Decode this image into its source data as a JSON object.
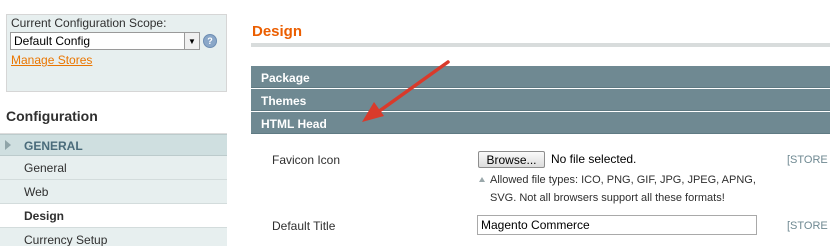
{
  "scope": {
    "label": "Current Configuration Scope:",
    "selected": "Default Config",
    "help_glyph": "?",
    "manage_link": "Manage Stores"
  },
  "sidebar": {
    "title": "Configuration",
    "group": "GENERAL",
    "items": [
      {
        "label": "General",
        "active": false
      },
      {
        "label": "Web",
        "active": false
      },
      {
        "label": "Design",
        "active": true
      },
      {
        "label": "Currency Setup",
        "active": false
      }
    ]
  },
  "main": {
    "title": "Design",
    "sections": [
      "Package",
      "Themes",
      "HTML Head"
    ],
    "fields": {
      "favicon": {
        "label": "Favicon Icon",
        "browse_label": "Browse...",
        "file_status": "No file selected.",
        "note_line1": "Allowed file types: ICO, PNG, GIF, JPG, JPEG, APNG,",
        "note_line2": "SVG. Not all browsers support all these formats!",
        "scope": "[STORE"
      },
      "default_title": {
        "label": "Default Title",
        "value": "Magento Commerce",
        "scope": "[STORE"
      }
    }
  },
  "colors": {
    "accent": "#eb5e00",
    "section_header": "#6f8992",
    "annotation_arrow": "#d93a2b"
  }
}
